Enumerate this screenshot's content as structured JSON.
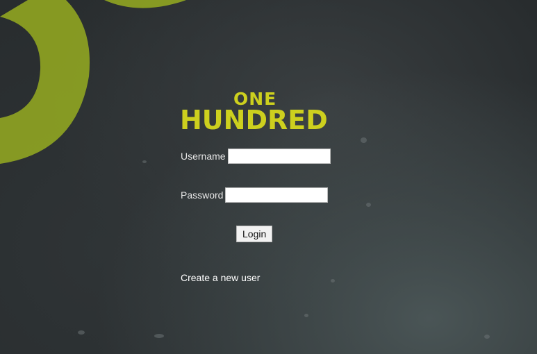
{
  "brand": {
    "line1": "ONE",
    "line2": "HUNDRED",
    "color": "#cdd01e"
  },
  "form": {
    "username_label": "Username",
    "username_value": "",
    "password_label": "Password",
    "password_value": "",
    "login_label": "Login",
    "create_user_link": "Create a new user"
  }
}
